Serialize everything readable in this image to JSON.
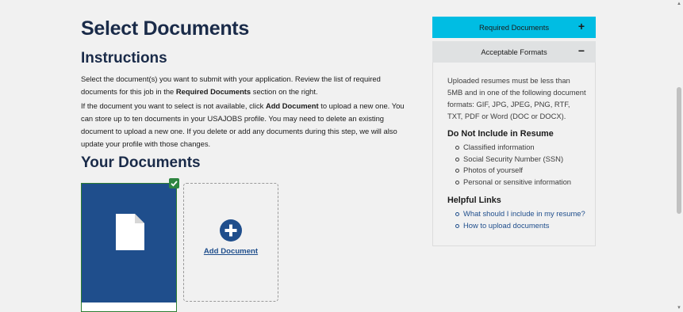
{
  "page": {
    "title": "Select Documents"
  },
  "instructions": {
    "title": "Instructions",
    "p1_a": "Select the document(s) you want to submit with your application. Review the list of required documents for this job in the ",
    "p1_b": "Required Documents",
    "p1_c": " section on the right.",
    "p2_a": "If the document you want to select is not available, click ",
    "p2_b": "Add Document",
    "p2_c": " to upload a new one. You can store up to ten documents in your USAJOBS profile. You may need to delete an existing document to upload a new one. If you delete or add any documents during this step, we will also update your profile with those changes."
  },
  "documents": {
    "title": "Your Documents",
    "add_label": "Add Document",
    "colors": {
      "card": "#1f4e8c",
      "check": "#2e8540"
    }
  },
  "sidebar": {
    "required": {
      "label": "Required Documents",
      "toggle": "+",
      "color": "#00bde3"
    },
    "acceptable": {
      "label": "Acceptable Formats",
      "toggle": "−",
      "body": "Uploaded resumes must be less than 5MB and in one of the following document formats: GIF, JPG, JPEG, PNG, RTF, TXT, PDF or Word (DOC or DOCX).",
      "do_not_title": "Do Not Include in Resume",
      "do_not_items": [
        "Classified information",
        "Social Security Number (SSN)",
        "Photos of yourself",
        "Personal or sensitive information"
      ],
      "links_title": "Helpful Links",
      "links": [
        "What should I include in my resume?",
        "How to upload documents"
      ]
    }
  }
}
